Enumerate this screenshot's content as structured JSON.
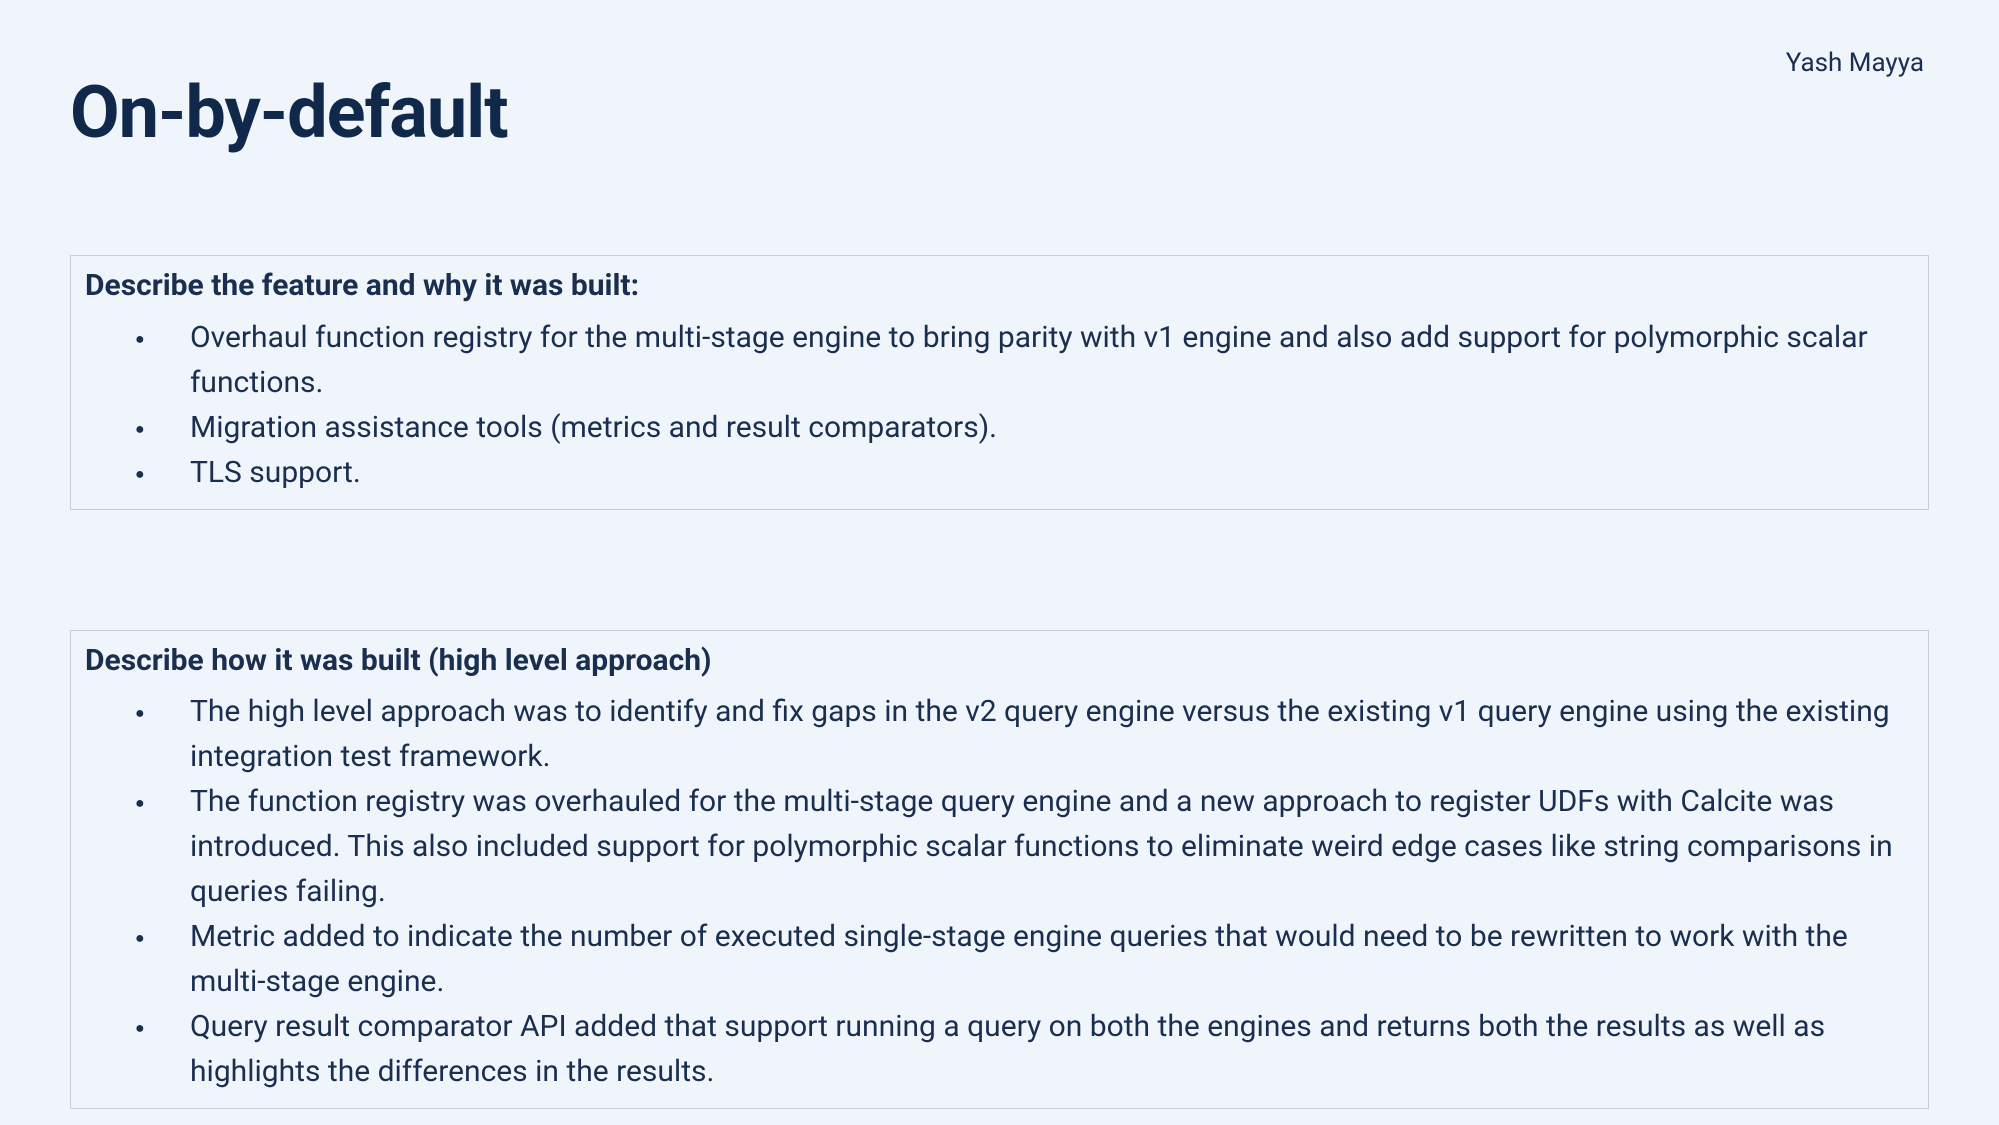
{
  "author": "Yash Mayya",
  "title": "On-by-default",
  "sections": [
    {
      "heading": "Describe the feature and why it was built:",
      "bullets": [
        "Overhaul function registry for the multi-stage engine to bring parity with v1 engine and also add support for polymorphic scalar functions.",
        "Migration assistance tools (metrics and result comparators).",
        "TLS support."
      ]
    },
    {
      "heading": "Describe how it was built (high level approach)",
      "bullets": [
        "The high level approach was to identify and fix gaps in the v2 query engine versus the existing v1 query engine using the existing integration test framework.",
        "The function registry was overhauled for the multi-stage query engine and a new approach to register UDFs with Calcite was introduced. This also included support for polymorphic scalar functions to eliminate weird edge cases like string comparisons in queries failing.",
        "Metric added to indicate the number of executed single-stage engine queries that would need to be rewritten to work with the multi-stage engine.",
        "Query result comparator API added that support running a query on both the engines and returns both the results as well as highlights the differences in the results."
      ]
    }
  ]
}
